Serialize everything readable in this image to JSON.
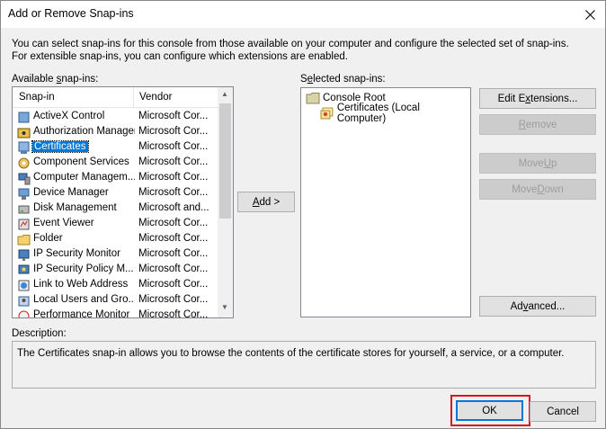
{
  "window": {
    "title": "Add or Remove Snap-ins"
  },
  "intro": "You can select snap-ins for this console from those available on your computer and configure the selected set of snap-ins. For extensible snap-ins, you can configure which extensions are enabled.",
  "available": {
    "label_pre": "Available ",
    "label_u": "s",
    "label_post": "nap-ins:",
    "col_snapin": "Snap-in",
    "col_vendor": "Vendor",
    "rows": [
      {
        "name": "ActiveX Control",
        "vendor": "Microsoft Cor...",
        "icon": "activex-icon"
      },
      {
        "name": "Authorization Manager",
        "vendor": "Microsoft Cor...",
        "icon": "authorization-icon"
      },
      {
        "name": "Certificates",
        "vendor": "Microsoft Cor...",
        "icon": "certificates-icon"
      },
      {
        "name": "Component Services",
        "vendor": "Microsoft Cor...",
        "icon": "component-services-icon"
      },
      {
        "name": "Computer Managem...",
        "vendor": "Microsoft Cor...",
        "icon": "computer-management-icon"
      },
      {
        "name": "Device Manager",
        "vendor": "Microsoft Cor...",
        "icon": "device-manager-icon"
      },
      {
        "name": "Disk Management",
        "vendor": "Microsoft and...",
        "icon": "disk-management-icon"
      },
      {
        "name": "Event Viewer",
        "vendor": "Microsoft Cor...",
        "icon": "event-viewer-icon"
      },
      {
        "name": "Folder",
        "vendor": "Microsoft Cor...",
        "icon": "folder-icon"
      },
      {
        "name": "IP Security Monitor",
        "vendor": "Microsoft Cor...",
        "icon": "ip-security-monitor-icon"
      },
      {
        "name": "IP Security Policy M...",
        "vendor": "Microsoft Cor...",
        "icon": "ip-security-policy-icon"
      },
      {
        "name": "Link to Web Address",
        "vendor": "Microsoft Cor...",
        "icon": "web-link-icon"
      },
      {
        "name": "Local Users and Gro...",
        "vendor": "Microsoft Cor...",
        "icon": "local-users-icon"
      },
      {
        "name": "Performance Monitor",
        "vendor": "Microsoft Cor...",
        "icon": "performance-monitor-icon"
      }
    ],
    "selected_index": 2
  },
  "add_button": {
    "u": "A",
    "rest": "dd >"
  },
  "selected": {
    "label_pre": "S",
    "label_u": "e",
    "label_post": "lected snap-ins:",
    "root": "Console Root",
    "child": "Certificates (Local Computer)"
  },
  "side_buttons": {
    "edit_pre": "Edit E",
    "edit_u": "x",
    "edit_post": "tensions...",
    "remove_pre": "",
    "remove_u": "R",
    "remove_post": "emove",
    "moveup_pre": "Move ",
    "moveup_u": "U",
    "moveup_post": "p",
    "movedown_pre": "Move ",
    "movedown_u": "D",
    "movedown_post": "own",
    "advanced_pre": "Ad",
    "advanced_u": "v",
    "advanced_post": "anced..."
  },
  "description": {
    "label": "Description:",
    "text": "The Certificates snap-in allows you to browse the contents of the certificate stores for yourself, a service, or a computer."
  },
  "footer": {
    "ok": "OK",
    "cancel": "Cancel"
  },
  "colors": {
    "selection": "#0078d7",
    "highlight_frame": "#d9141c"
  }
}
